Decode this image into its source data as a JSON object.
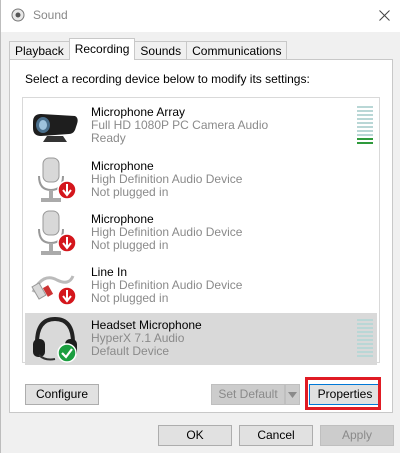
{
  "window": {
    "title": "Sound"
  },
  "tabs": [
    {
      "label": "Playback"
    },
    {
      "label": "Recording"
    },
    {
      "label": "Sounds"
    },
    {
      "label": "Communications"
    }
  ],
  "instruction": "Select a recording device below to modify its settings:",
  "devices": [
    {
      "name": "Microphone Array",
      "description": "Full HD 1080P PC Camera Audio",
      "status": "Ready",
      "icon": "camera-mic-icon",
      "level_segments_on": 2,
      "selected": false
    },
    {
      "name": "Microphone",
      "description": "High Definition Audio Device",
      "status": "Not plugged in",
      "icon": "microphone-icon",
      "selected": false
    },
    {
      "name": "Microphone",
      "description": "High Definition Audio Device",
      "status": "Not plugged in",
      "icon": "microphone-icon",
      "selected": false
    },
    {
      "name": "Line In",
      "description": "High Definition Audio Device",
      "status": "Not plugged in",
      "icon": "line-in-icon",
      "selected": false
    },
    {
      "name": "Headset Microphone",
      "description": "HyperX 7.1 Audio",
      "status": "Default Device",
      "icon": "headset-icon",
      "level_segments_on": 0,
      "selected": true
    }
  ],
  "buttons": {
    "configure": "Configure",
    "set_default": "Set Default",
    "properties": "Properties",
    "ok": "OK",
    "cancel": "Cancel",
    "apply": "Apply"
  },
  "colors": {
    "level_on": "#2e9a3c",
    "level_off": "#b9d7d6",
    "highlight": "#e01b24",
    "status_unplugged": "#d4161c",
    "status_default": "#1a9e3f"
  }
}
